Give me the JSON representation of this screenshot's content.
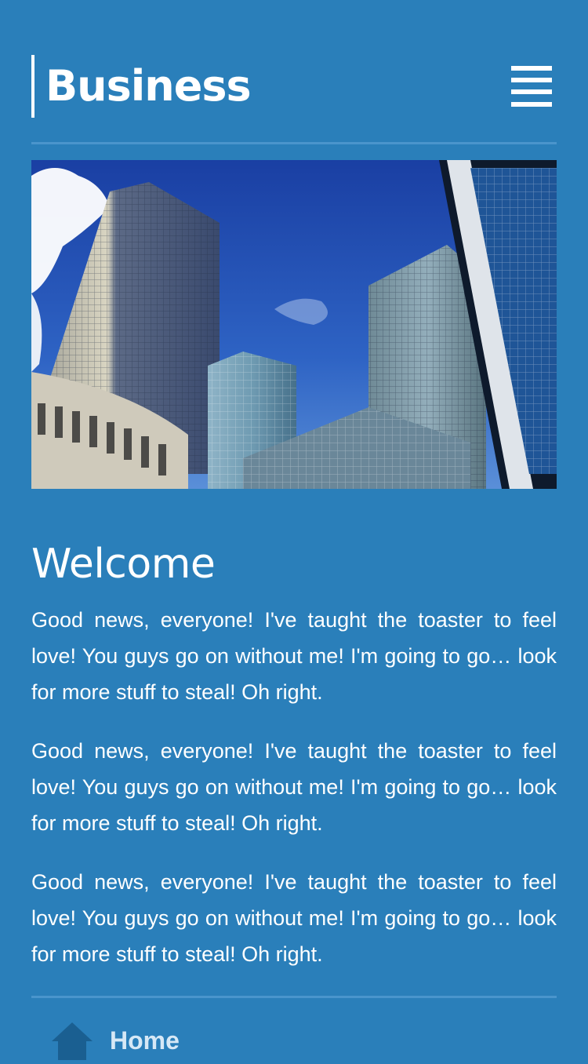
{
  "header": {
    "logo_text": "Business",
    "menu_icon": "hamburger-menu-icon"
  },
  "hero": {
    "image_alt": "city-skyscrapers-image"
  },
  "main": {
    "title": "Welcome",
    "paragraphs": [
      "Good news, everyone! I've taught the toaster to feel love! You guys go on without me! I'm going to go… look for more stuff to steal! Oh right.",
      "Good news, everyone! I've taught the toaster to feel love! You guys go on without me! I'm going to go… look for more stuff to steal! Oh right.",
      "Good news, everyone! I've taught the toaster to feel love! You guys go on without me! I'm going to go… look for more stuff to steal! Oh right."
    ]
  },
  "nav": {
    "home_label": "Home",
    "home_icon": "home-icon"
  },
  "colors": {
    "background": "#2a7fba",
    "divider": "#4a95cc",
    "text": "#ffffff",
    "home_icon": "#1a5f91"
  }
}
